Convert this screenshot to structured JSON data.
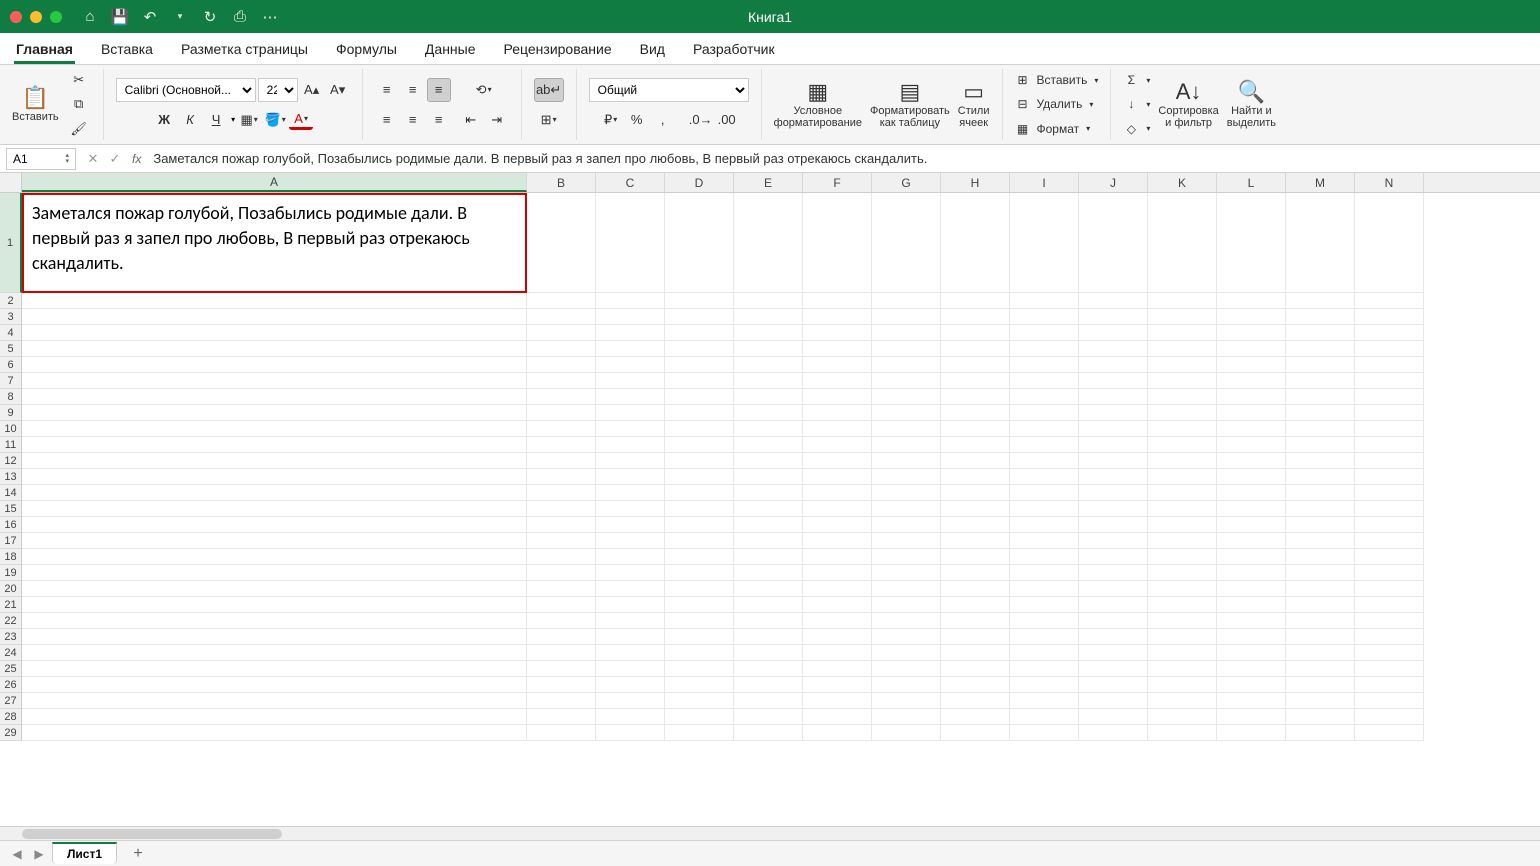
{
  "titlebar": {
    "title": "Книга1"
  },
  "tabs": [
    "Главная",
    "Вставка",
    "Разметка страницы",
    "Формулы",
    "Данные",
    "Рецензирование",
    "Вид",
    "Разработчик"
  ],
  "activeTab": 0,
  "ribbon": {
    "paste": "Вставить",
    "font_name": "Calibri (Основной...",
    "font_size": "22",
    "number_format": "Общий",
    "cond_fmt": "Условное\nформатирование",
    "fmt_table": "Форматировать\nкак таблицу",
    "cell_styles": "Стили\nячеек",
    "insert": "Вставить",
    "delete": "Удалить",
    "format": "Формат",
    "sort_filter": "Сортировка\nи фильтр",
    "find_select": "Найти и\nвыделить"
  },
  "formula_bar": {
    "name_box": "A1",
    "formula": "Заметался пожар голубой, Позабылись родимые дали. В первый раз я запел про любовь, В первый раз отрекаюсь скандалить."
  },
  "grid": {
    "columns": [
      "A",
      "B",
      "C",
      "D",
      "E",
      "F",
      "G",
      "H",
      "I",
      "J",
      "K",
      "L",
      "M",
      "N"
    ],
    "col_widths": {
      "A": 505,
      "other": 69
    },
    "row_count": 29,
    "selected_cell": "A1",
    "a1_content": "Заметался пожар голубой, Позабылись родимые дали. В первый раз я запел про любовь, В первый раз отрекаюсь скандалить."
  },
  "sheets": {
    "active": "Лист1"
  }
}
